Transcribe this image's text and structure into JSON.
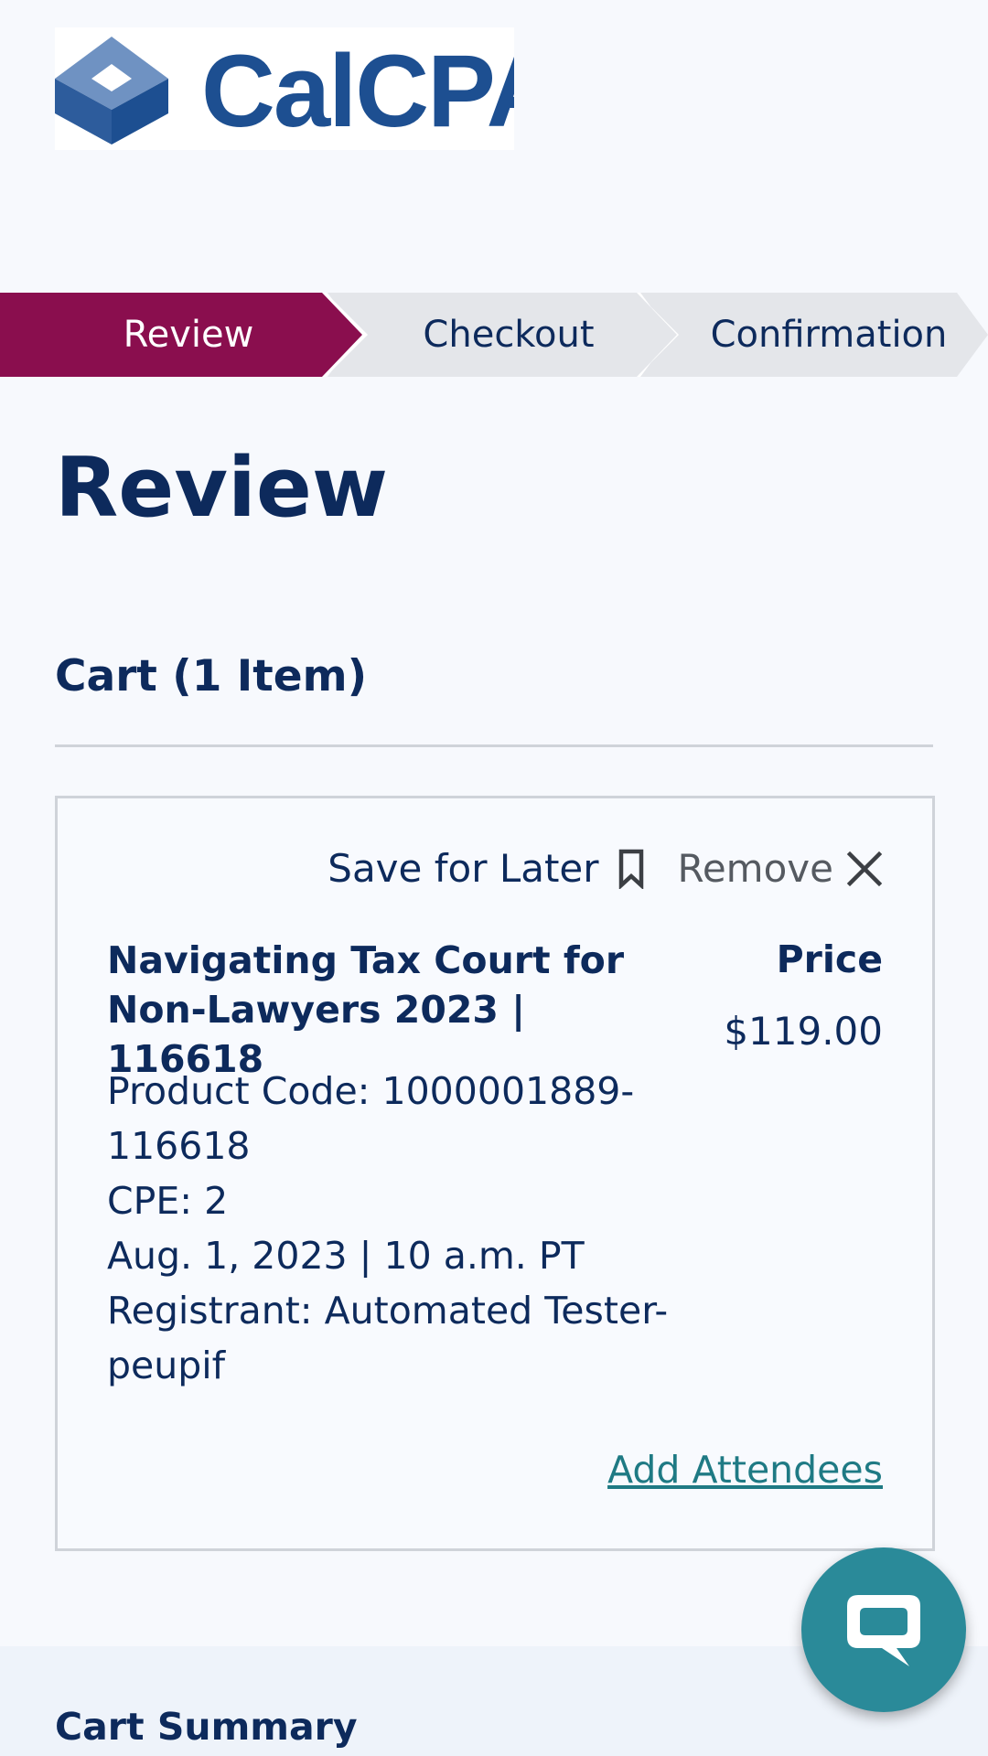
{
  "brand": {
    "logo_text": "CalCPA",
    "primary_color": "#1d4f91",
    "step_active_color": "#8a0e4e"
  },
  "stepper": {
    "steps": [
      {
        "label": "Review",
        "state": "active"
      },
      {
        "label": "Checkout",
        "state": "upcoming"
      },
      {
        "label": "Confirmation",
        "state": "upcoming"
      }
    ]
  },
  "page": {
    "title": "Review"
  },
  "cart": {
    "heading": "Cart (1 Item)",
    "item": {
      "save_for_later_label": "Save for Later",
      "remove_label": "Remove",
      "title": "Navigating Tax Court for Non-Lawyers 2023 | 116618",
      "details": [
        "Product Code: 1000001889-116618",
        "CPE: 2",
        "Aug. 1, 2023 | 10 a.m. PT",
        "Registrant: Automated Tester-peupif"
      ],
      "price_label": "Price",
      "price": "$119.00",
      "add_attendees_label": "Add Attendees"
    }
  },
  "summary": {
    "title": "Cart Summary"
  },
  "icons": {
    "save": "bookmark-icon",
    "remove": "close-icon",
    "chat": "chat-bubble-icon"
  }
}
